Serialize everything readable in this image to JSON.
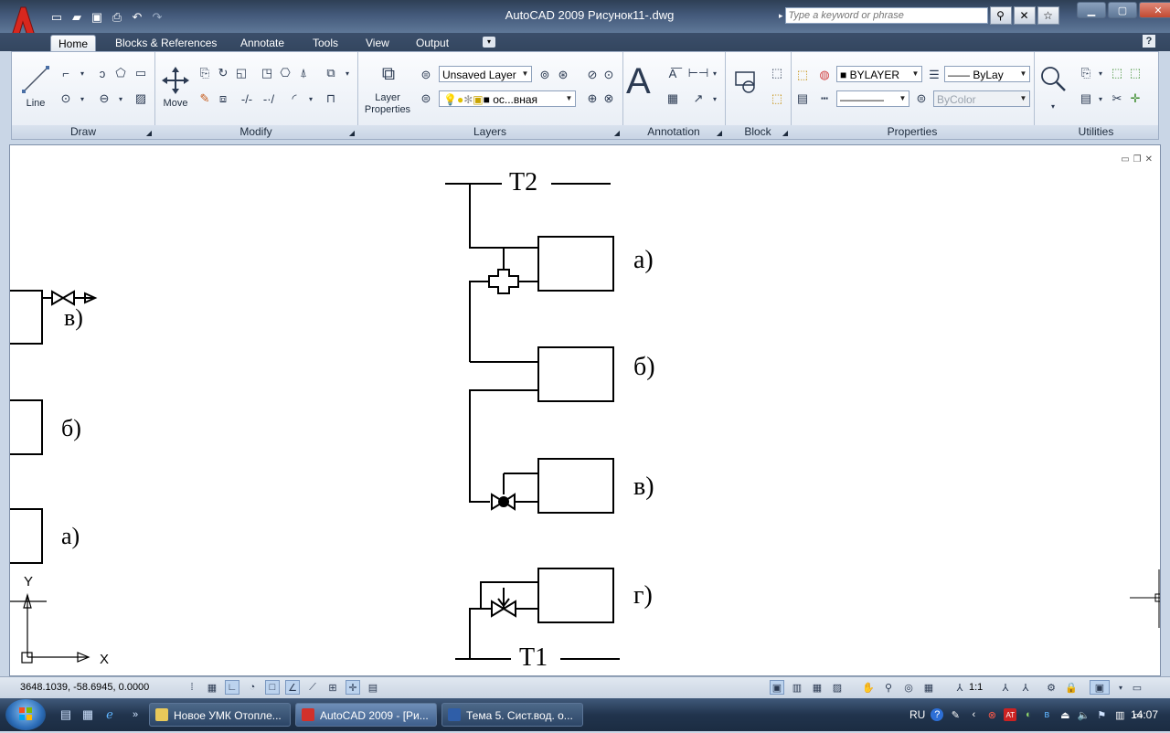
{
  "window": {
    "title": "AutoCAD 2009 Рисунок11-.dwg",
    "search_placeholder": "Type a keyword or phrase",
    "app_logo_letter": "A"
  },
  "ribbon_tabs": [
    "Home",
    "Blocks & References",
    "Annotate",
    "Tools",
    "View",
    "Output"
  ],
  "panels": {
    "draw": {
      "title": "Draw",
      "line_label": "Line"
    },
    "modify": {
      "title": "Modify",
      "move_label": "Move"
    },
    "layers": {
      "title": "Layers",
      "layer_properties_line1": "Layer",
      "layer_properties_line2": "Properties",
      "layer_combo": "Unsaved Layer",
      "layer_state_combo": "ос...вная"
    },
    "annotation": {
      "title": "Annotation",
      "text_glyph": "A"
    },
    "block": {
      "title": "Block"
    },
    "properties": {
      "title": "Properties",
      "color_combo": "BYLAYER",
      "linetype_combo": "ByLay",
      "plotstyle_combo": "ByColor"
    },
    "utilities": {
      "title": "Utilities"
    }
  },
  "drawing": {
    "right_scheme": {
      "supply_label": "T2",
      "return_label": "T1",
      "labels": [
        "а)",
        "б)",
        "в)",
        "г)"
      ]
    },
    "left_scheme": {
      "labels": [
        "в)",
        "б)",
        "а)"
      ]
    },
    "ucs": {
      "x_label": "X",
      "y_label": "Y"
    }
  },
  "statusbar": {
    "coordinates": "3648.1039, -58.6945, 0.0000",
    "annotation_scale": "1:1"
  },
  "taskbar": {
    "items": [
      {
        "label": "Новое УМК Отопле...",
        "icon_color": "#e8c95a"
      },
      {
        "label": "AutoCAD 2009 - [Ри...",
        "icon_color": "#d2312a"
      },
      {
        "label": "Тема 5. Сист.вод. о...",
        "icon_color": "#2f5ea8"
      }
    ],
    "language": "RU",
    "clock": "14:07"
  }
}
